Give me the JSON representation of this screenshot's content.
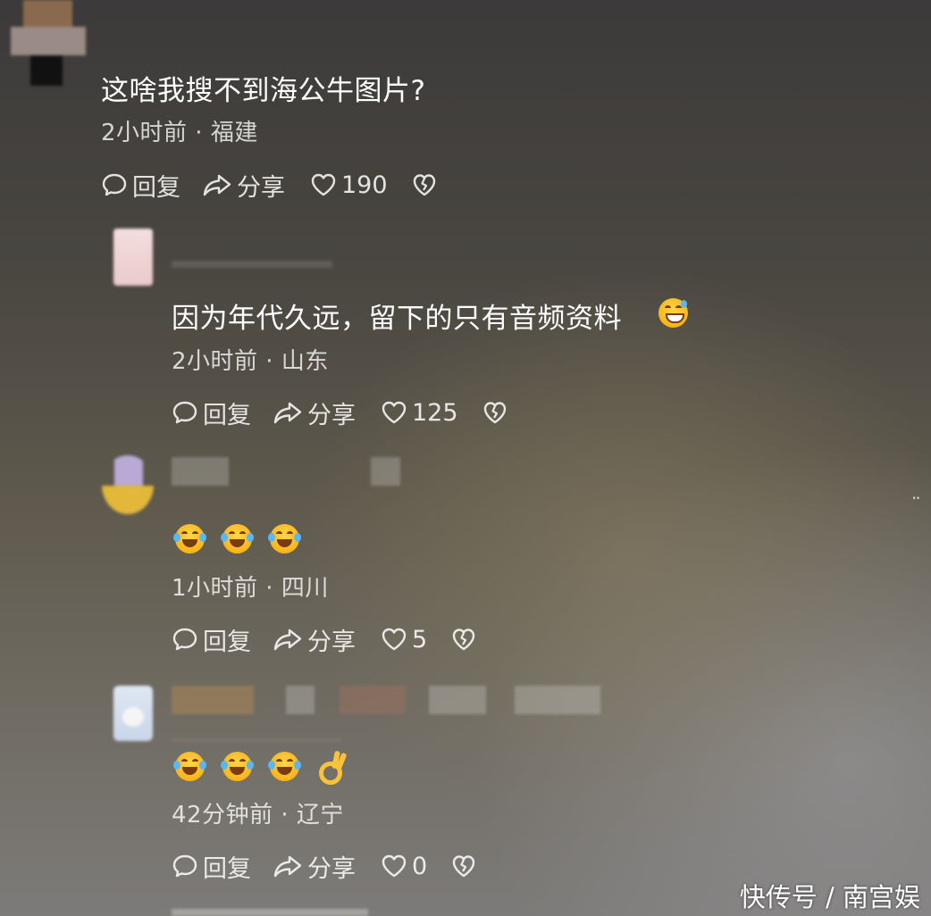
{
  "comments": [
    {
      "text": "这啥我搜不到海公牛图片?",
      "meta": "2小时前 · 福建",
      "reply": "回复",
      "share": "分享",
      "likes": "190"
    },
    {
      "text": "因为年代久远，留下的只有音频资料",
      "meta": "2小时前 · 山东",
      "reply": "回复",
      "share": "分享",
      "likes": "125"
    },
    {
      "emojis": [
        "rolling-laugh-emoji",
        "rolling-laugh-emoji",
        "rolling-laugh-emoji"
      ],
      "meta": "1小时前 · 四川",
      "reply": "回复",
      "share": "分享",
      "likes": "5"
    },
    {
      "emojis": [
        "rolling-laugh-emoji",
        "rolling-laugh-emoji",
        "rolling-laugh-emoji",
        "ok-hand-emoji"
      ],
      "meta": "42分钟前 · 辽宁",
      "reply": "回复",
      "share": "分享",
      "likes": "0"
    }
  ],
  "watermark": "快传号 / 南宫娱",
  "icons": {
    "reply": "comment-bubble-icon",
    "share": "share-arrow-icon",
    "like": "heart-icon",
    "dislike": "broken-heart-icon"
  },
  "colors": {
    "text": "#ffffff",
    "meta": "rgba(255,255,255,0.78)"
  }
}
